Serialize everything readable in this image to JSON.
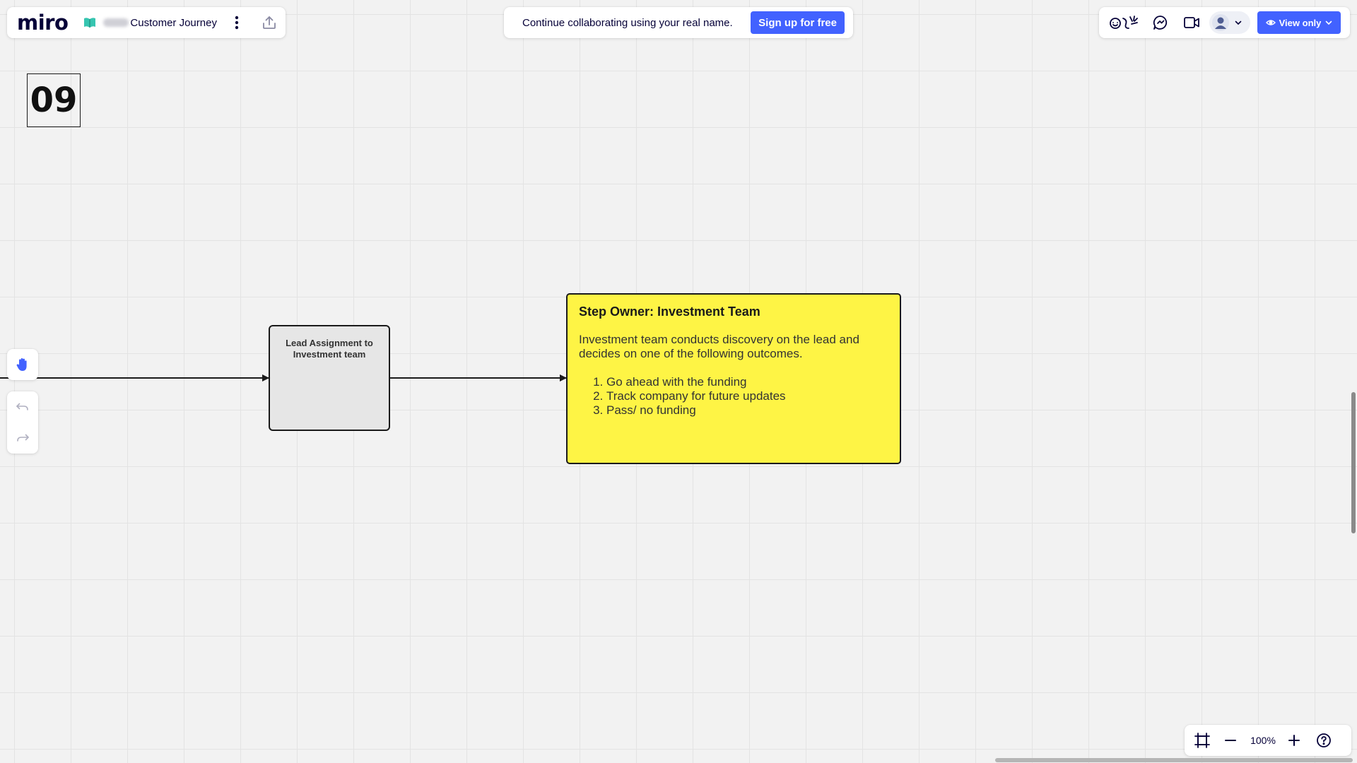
{
  "app": {
    "logo": "miro"
  },
  "board": {
    "title": "Customer Journey"
  },
  "banner": {
    "text": "Continue collaborating using your real name.",
    "signup_label": "Sign up for free"
  },
  "access": {
    "label": "View only"
  },
  "canvas": {
    "frame_label": "09",
    "lead_shape_text": "Lead Assignment to Investment team",
    "sticky": {
      "title": "Step Owner: Investment Team",
      "body": "Investment team conducts discovery on the lead and decides on one of the following outcomes.",
      "outcomes": [
        "Go ahead with the funding",
        "Track company for future updates",
        "Pass/ no funding"
      ],
      "color": "#fef445"
    }
  },
  "zoom": {
    "level": "100%"
  },
  "colors": {
    "accent": "#4262ff",
    "canvas_bg": "#f2f2f2",
    "board_icon": "#36c5b0"
  },
  "icons": [
    "board-book-icon",
    "more-vertical-icon",
    "share-upload-icon",
    "reactions-icon",
    "comment-icon",
    "video-icon",
    "user-avatar-icon",
    "chevron-down-icon",
    "eye-icon",
    "hand-tool-icon",
    "undo-icon",
    "redo-icon",
    "fit-screen-icon",
    "zoom-out-icon",
    "zoom-in-icon",
    "help-icon"
  ]
}
